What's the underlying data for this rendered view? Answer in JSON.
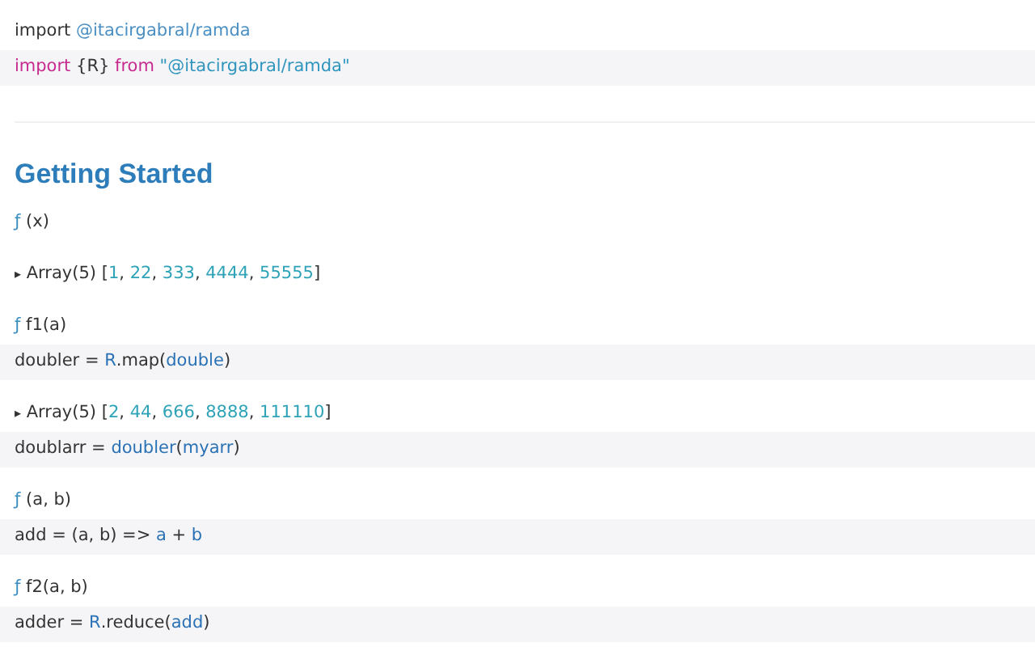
{
  "cells": [
    {
      "kind": "output",
      "tokens": [
        {
          "kind": "plain",
          "text": "import "
        },
        {
          "kind": "link",
          "text": "@itacirgabral/ramda"
        }
      ]
    },
    {
      "kind": "code",
      "tokens": [
        {
          "kind": "keyword",
          "text": "import"
        },
        {
          "kind": "plain",
          "text": " {R} "
        },
        {
          "kind": "keyword",
          "text": "from"
        },
        {
          "kind": "string",
          "text": " \"@itacirgabral/ramda\""
        }
      ]
    },
    {
      "kind": "divider"
    },
    {
      "kind": "heading",
      "text": "Getting Started"
    },
    {
      "kind": "output",
      "tokens": [
        {
          "kind": "fn",
          "text": "ƒ"
        },
        {
          "kind": "plain",
          "text": " (x)"
        }
      ]
    },
    {
      "kind": "output",
      "tokens": [
        {
          "kind": "caret",
          "text": "▸"
        },
        {
          "kind": "plain",
          "text": " Array(5) ["
        },
        {
          "kind": "number",
          "text": "1"
        },
        {
          "kind": "plain",
          "text": ", "
        },
        {
          "kind": "number",
          "text": "22"
        },
        {
          "kind": "plain",
          "text": ", "
        },
        {
          "kind": "number",
          "text": "333"
        },
        {
          "kind": "plain",
          "text": ", "
        },
        {
          "kind": "number",
          "text": "4444"
        },
        {
          "kind": "plain",
          "text": ", "
        },
        {
          "kind": "number",
          "text": "55555"
        },
        {
          "kind": "plain",
          "text": "]"
        }
      ]
    },
    {
      "kind": "output",
      "tokens": [
        {
          "kind": "fn",
          "text": "ƒ"
        },
        {
          "kind": "plain",
          "text": " f1(a)"
        }
      ]
    },
    {
      "kind": "code",
      "tokens": [
        {
          "kind": "plain",
          "text": "doubler = "
        },
        {
          "kind": "ref",
          "text": "R"
        },
        {
          "kind": "plain",
          "text": ".map("
        },
        {
          "kind": "ref",
          "text": "double"
        },
        {
          "kind": "plain",
          "text": ")"
        }
      ]
    },
    {
      "kind": "output",
      "tokens": [
        {
          "kind": "caret",
          "text": "▸"
        },
        {
          "kind": "plain",
          "text": " Array(5) ["
        },
        {
          "kind": "number",
          "text": "2"
        },
        {
          "kind": "plain",
          "text": ", "
        },
        {
          "kind": "number",
          "text": "44"
        },
        {
          "kind": "plain",
          "text": ", "
        },
        {
          "kind": "number",
          "text": "666"
        },
        {
          "kind": "plain",
          "text": ", "
        },
        {
          "kind": "number",
          "text": "8888"
        },
        {
          "kind": "plain",
          "text": ", "
        },
        {
          "kind": "number",
          "text": "111110"
        },
        {
          "kind": "plain",
          "text": "]"
        }
      ]
    },
    {
      "kind": "code",
      "tokens": [
        {
          "kind": "plain",
          "text": "doublarr = "
        },
        {
          "kind": "ref",
          "text": "doubler"
        },
        {
          "kind": "plain",
          "text": "("
        },
        {
          "kind": "ref",
          "text": "myarr"
        },
        {
          "kind": "plain",
          "text": ")"
        }
      ]
    },
    {
      "kind": "output",
      "tokens": [
        {
          "kind": "fn",
          "text": "ƒ"
        },
        {
          "kind": "plain",
          "text": " (a, b)"
        }
      ]
    },
    {
      "kind": "code",
      "tokens": [
        {
          "kind": "plain",
          "text": "add = (a, b) => "
        },
        {
          "kind": "ref",
          "text": "a"
        },
        {
          "kind": "plain",
          "text": " + "
        },
        {
          "kind": "ref",
          "text": "b"
        }
      ]
    },
    {
      "kind": "output",
      "tokens": [
        {
          "kind": "fn",
          "text": "ƒ"
        },
        {
          "kind": "plain",
          "text": " f2(a, b)"
        }
      ]
    },
    {
      "kind": "code",
      "tokens": [
        {
          "kind": "plain",
          "text": "adder = "
        },
        {
          "kind": "ref",
          "text": "R"
        },
        {
          "kind": "plain",
          "text": ".reduce("
        },
        {
          "kind": "ref",
          "text": "add"
        },
        {
          "kind": "plain",
          "text": ")"
        }
      ]
    }
  ]
}
